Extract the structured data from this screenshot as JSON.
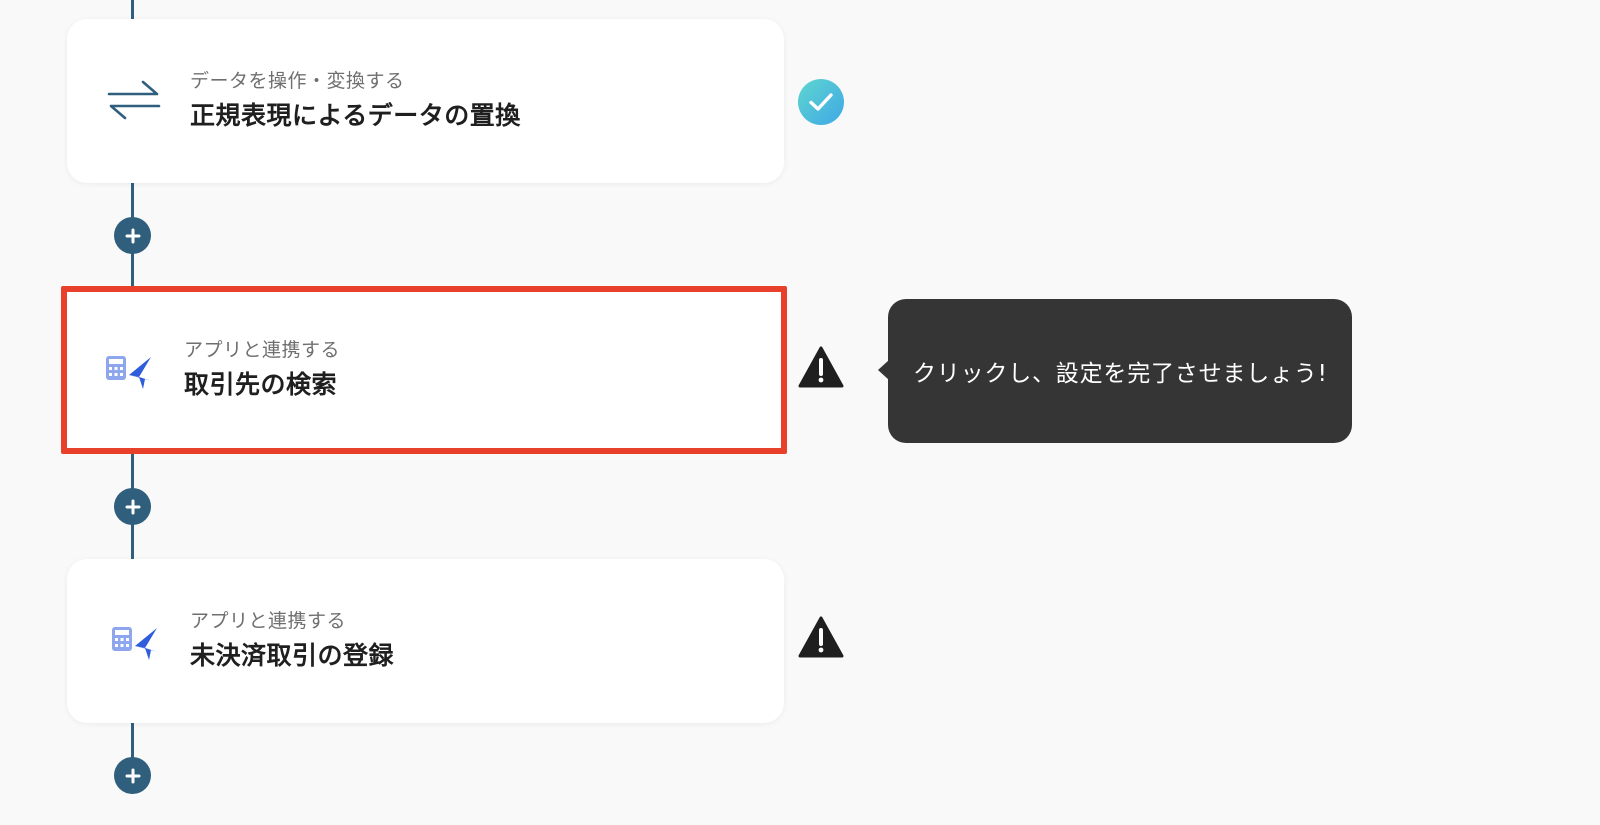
{
  "steps": [
    {
      "subtitle": "データを操作・変換する",
      "title": "正規表現によるデータの置換",
      "icon": "arrows-swap-icon",
      "status": "complete"
    },
    {
      "subtitle": "アプリと連携する",
      "title": "取引先の検索",
      "icon": "freee-accounting-app-icon",
      "status": "warning",
      "highlighted": true
    },
    {
      "subtitle": "アプリと連携する",
      "title": "未決済取引の登録",
      "icon": "freee-accounting-app-icon",
      "status": "warning"
    }
  ],
  "tooltip": {
    "text": "クリックし、設定を完了させましょう!"
  },
  "colors": {
    "connector": "#2f5f7d",
    "highlight_border": "#e8402a",
    "check_badge": "#4cc3d9",
    "warning": "#1f1f1f",
    "tooltip_bg": "#353535"
  }
}
